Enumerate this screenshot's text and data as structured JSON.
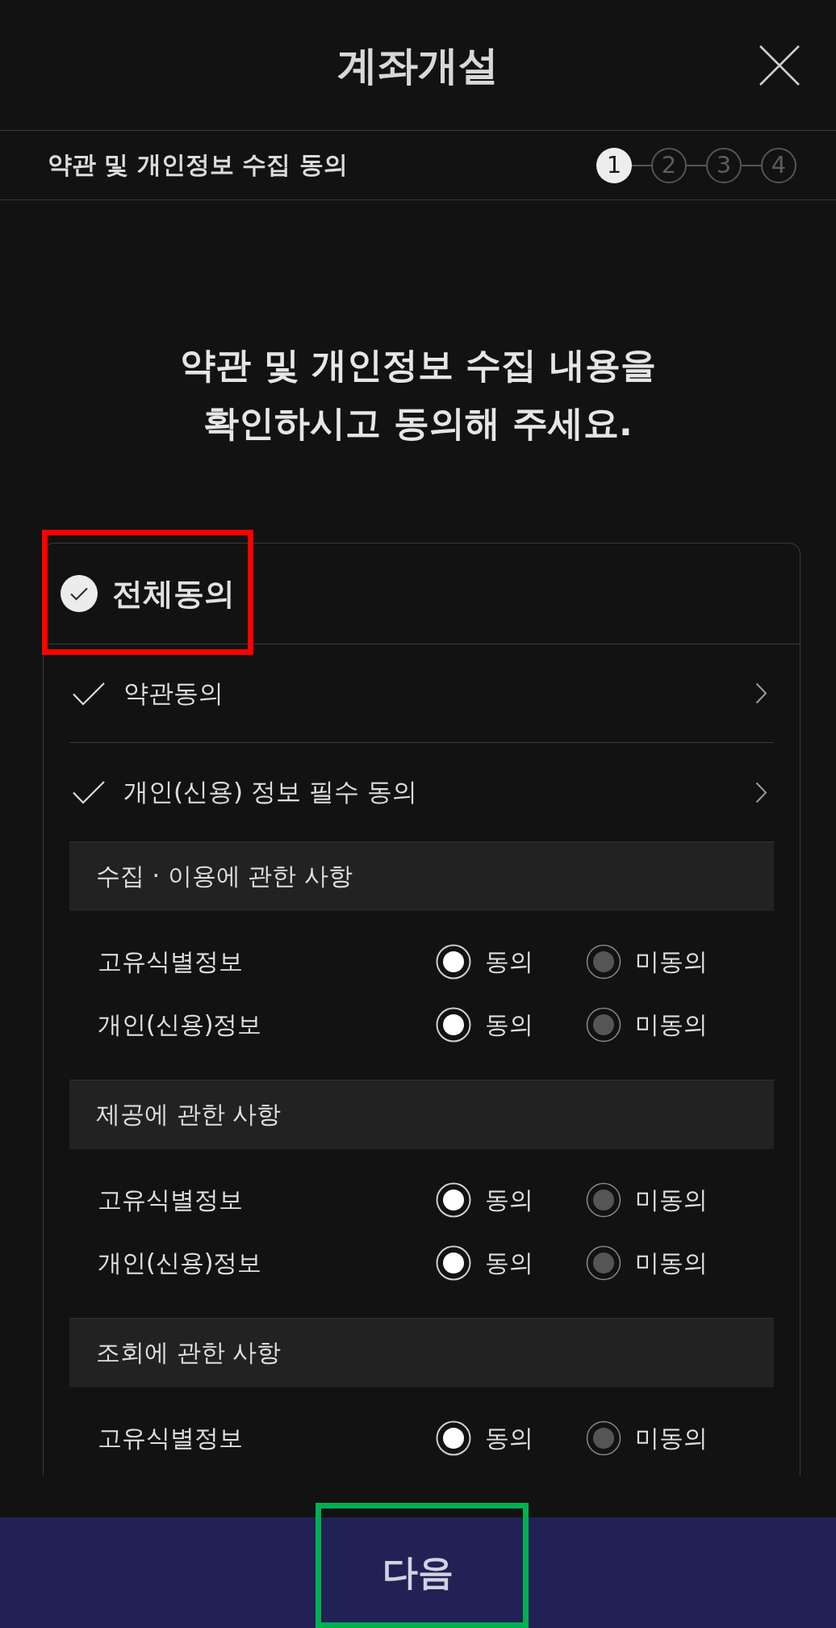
{
  "header": {
    "title": "계좌개설"
  },
  "progress": {
    "title": "약관 및 개인정보 수집 동의",
    "steps": [
      {
        "label": "1",
        "selected": true
      },
      {
        "label": "2",
        "selected": false
      },
      {
        "label": "3",
        "selected": false
      },
      {
        "label": "4",
        "selected": false
      }
    ]
  },
  "intro": "약관 및 개인정보 수집 내용을\n확인하시고 동의해 주세요.",
  "agreement": {
    "all": {
      "label": "전체동의",
      "checked": true,
      "highlight": {
        "color": "#ff0000"
      }
    },
    "items": [
      {
        "label": "약관동의",
        "checked": true
      },
      {
        "label": "개인(신용) 정보 필수 동의",
        "checked": true
      }
    ],
    "sections": [
      {
        "title": "수집 · 이용에 관한 사항",
        "rows": [
          {
            "label": "고유식별정보",
            "options": [
              {
                "label": "동의",
                "selected": true
              },
              {
                "label": "미동의",
                "selected": false
              }
            ]
          },
          {
            "label": "개인(신용)정보",
            "options": [
              {
                "label": "동의",
                "selected": true
              },
              {
                "label": "미동의",
                "selected": false
              }
            ]
          }
        ]
      },
      {
        "title": "제공에 관한 사항",
        "rows": [
          {
            "label": "고유식별정보",
            "options": [
              {
                "label": "동의",
                "selected": true
              },
              {
                "label": "미동의",
                "selected": false
              }
            ]
          },
          {
            "label": "개인(신용)정보",
            "options": [
              {
                "label": "동의",
                "selected": true
              },
              {
                "label": "미동의",
                "selected": false
              }
            ]
          }
        ]
      },
      {
        "title": "조회에 관한 사항",
        "rows": [
          {
            "label": "고유식별정보",
            "options": [
              {
                "label": "동의",
                "selected": true
              },
              {
                "label": "미동의",
                "selected": false
              }
            ]
          }
        ]
      }
    ]
  },
  "next_button": {
    "label": "다음",
    "highlight": {
      "color": "#00b050"
    }
  }
}
